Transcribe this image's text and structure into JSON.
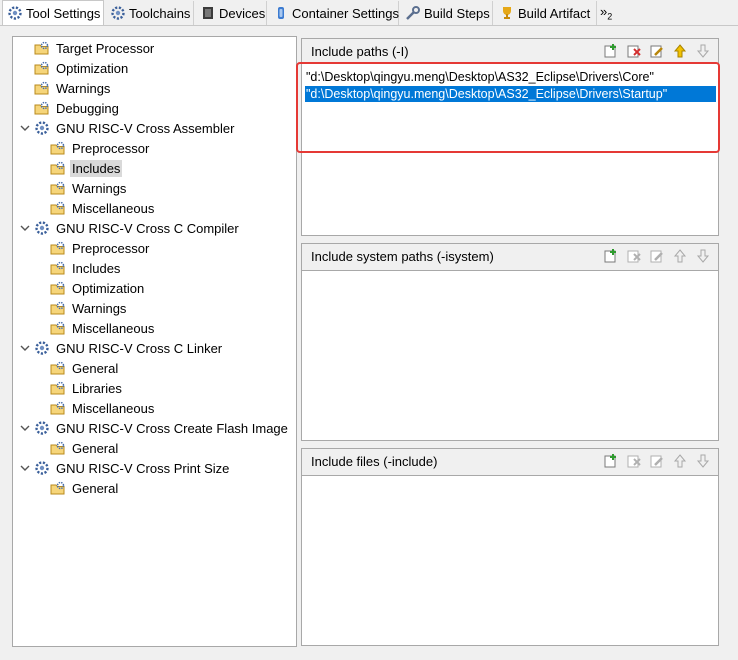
{
  "tabs": [
    {
      "label": "Tool Settings",
      "icon": "gear-icon"
    },
    {
      "label": "Toolchains",
      "icon": "gear-icon"
    },
    {
      "label": "Devices",
      "icon": "chip-icon"
    },
    {
      "label": "Container Settings",
      "icon": "container-icon"
    },
    {
      "label": "Build Steps",
      "icon": "wrench-icon"
    },
    {
      "label": "Build Artifact",
      "icon": "trophy-icon"
    }
  ],
  "overflow": {
    "label": "»",
    "count": "2"
  },
  "tree": {
    "items": [
      {
        "label": "Target Processor",
        "level": 0,
        "icon": "settings-page-icon"
      },
      {
        "label": "Optimization",
        "level": 0,
        "icon": "settings-page-icon"
      },
      {
        "label": "Warnings",
        "level": 0,
        "icon": "settings-page-icon"
      },
      {
        "label": "Debugging",
        "level": 0,
        "icon": "settings-page-icon"
      },
      {
        "label": "GNU RISC-V Cross Assembler",
        "level": 0,
        "icon": "tool-icon",
        "expanded": true
      },
      {
        "label": "Preprocessor",
        "level": 1,
        "icon": "settings-page-icon"
      },
      {
        "label": "Includes",
        "level": 1,
        "icon": "settings-page-icon",
        "selected": true
      },
      {
        "label": "Warnings",
        "level": 1,
        "icon": "settings-page-icon"
      },
      {
        "label": "Miscellaneous",
        "level": 1,
        "icon": "settings-page-icon"
      },
      {
        "label": "GNU RISC-V Cross C Compiler",
        "level": 0,
        "icon": "tool-icon",
        "expanded": true
      },
      {
        "label": "Preprocessor",
        "level": 1,
        "icon": "settings-page-icon"
      },
      {
        "label": "Includes",
        "level": 1,
        "icon": "settings-page-icon"
      },
      {
        "label": "Optimization",
        "level": 1,
        "icon": "settings-page-icon"
      },
      {
        "label": "Warnings",
        "level": 1,
        "icon": "settings-page-icon"
      },
      {
        "label": "Miscellaneous",
        "level": 1,
        "icon": "settings-page-icon"
      },
      {
        "label": "GNU RISC-V Cross C Linker",
        "level": 0,
        "icon": "tool-icon",
        "expanded": true
      },
      {
        "label": "General",
        "level": 1,
        "icon": "settings-page-icon"
      },
      {
        "label": "Libraries",
        "level": 1,
        "icon": "settings-page-icon"
      },
      {
        "label": "Miscellaneous",
        "level": 1,
        "icon": "settings-page-icon"
      },
      {
        "label": "GNU RISC-V Cross Create Flash Image",
        "level": 0,
        "icon": "tool-icon",
        "expanded": true
      },
      {
        "label": "General",
        "level": 1,
        "icon": "settings-page-icon"
      },
      {
        "label": "GNU RISC-V Cross Print Size",
        "level": 0,
        "icon": "tool-icon",
        "expanded": true
      },
      {
        "label": "General",
        "level": 1,
        "icon": "settings-page-icon"
      }
    ]
  },
  "panels": {
    "include_paths": {
      "title": "Include paths (-I)",
      "paths": [
        "\"d:\\Desktop\\qingyu.meng\\Desktop\\AS32_Eclipse\\Drivers\\Core\"",
        "\"d:\\Desktop\\qingyu.meng\\Desktop\\AS32_Eclipse\\Drivers\\Startup\""
      ],
      "selected_index": 1
    },
    "include_system_paths": {
      "title": "Include system paths (-isystem)"
    },
    "include_files": {
      "title": "Include files (-include)"
    }
  },
  "toolbar_actions": [
    "add-icon",
    "delete-icon",
    "edit-icon",
    "move-up-icon",
    "move-down-icon"
  ],
  "colors": {
    "selection": "#0078d7",
    "highlight_box": "#e53935",
    "tree_selection": "#d9d9d9"
  }
}
